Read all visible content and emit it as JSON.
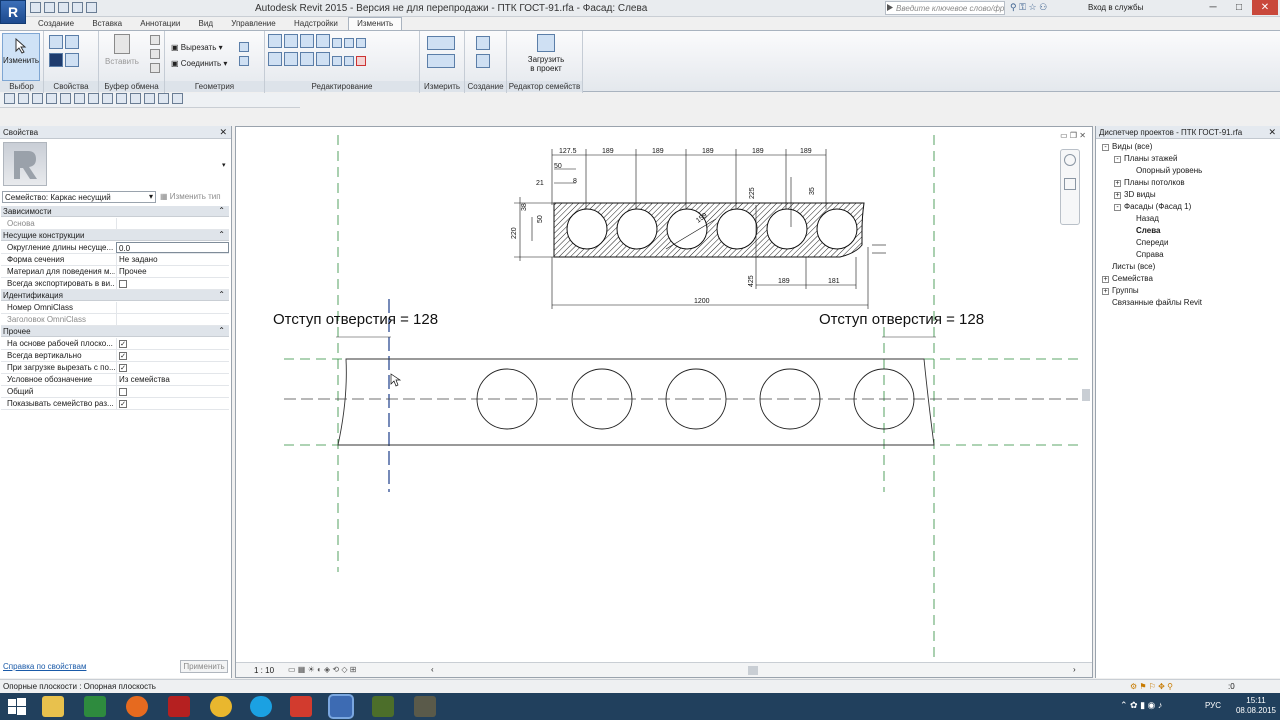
{
  "app": {
    "logo": "R",
    "title": "Autodesk Revit 2015 -  Версия не для перепродажи -    ПТК ГОСТ-91.rfa - Фасад: Слева",
    "search_placeholder": "Введите ключевое слово/фразу",
    "login_label": "Вход в службы",
    "win_min": "─",
    "win_max": "□",
    "win_close": "✕"
  },
  "tabs": [
    "Создание",
    "Вставка",
    "Аннотации",
    "Вид",
    "Управление",
    "Надстройки",
    "Изменить"
  ],
  "ribbon": {
    "modify_label": "Изменить",
    "panels": {
      "select": "Выбор",
      "properties": "Свойства",
      "clipboard": "Буфер обмена",
      "geometry": "Геометрия",
      "edit": "Редактирование",
      "measure": "Измерить",
      "create": "Создание",
      "family_editor": "Редактор семейств"
    },
    "paste_label": "Вставить",
    "cut_label": "Вырезать",
    "join_label": "Соединить",
    "load_label_1": "Загрузить",
    "load_label_2": "в проект"
  },
  "properties": {
    "title": "Свойства",
    "family_select": "Семейство: Каркас несущий",
    "edit_type": "Изменить тип",
    "groups": [
      {
        "name": "Зависимости",
        "rows": [
          {
            "k": "Основа",
            "v": "",
            "grey": true
          }
        ]
      },
      {
        "name": "Несущие конструкции",
        "rows": [
          {
            "k": "Округление длины несуще...",
            "v": "0.0"
          },
          {
            "k": "Форма сечения",
            "v": "Не задано"
          },
          {
            "k": "Материал для поведения м...",
            "v": "Прочее"
          },
          {
            "k": "Всегда экспортировать в ви...",
            "v": "",
            "check": false
          }
        ]
      },
      {
        "name": "Идентификация",
        "rows": [
          {
            "k": "Номер OmniClass",
            "v": ""
          },
          {
            "k": "Заголовок OmniClass",
            "v": "",
            "grey": true
          }
        ]
      },
      {
        "name": "Прочее",
        "rows": [
          {
            "k": "На основе рабочей плоско...",
            "v": "",
            "check": true
          },
          {
            "k": "Всегда вертикально",
            "v": "",
            "check": true
          },
          {
            "k": "При загрузке вырезать с по...",
            "v": "",
            "check": true
          },
          {
            "k": "Условное обозначение",
            "v": "Из семейства"
          },
          {
            "k": "Общий",
            "v": "",
            "check": false
          },
          {
            "k": "Показывать семейство раз...",
            "v": "",
            "check": true
          }
        ]
      }
    ],
    "help_link": "Справка по свойствам",
    "apply": "Применить"
  },
  "project_browser": {
    "title": "Диспетчер проектов - ПТК ГОСТ-91.rfa",
    "items": [
      {
        "label": "Виды (все)",
        "level": 0,
        "toggle": "-"
      },
      {
        "label": "Планы этажей",
        "level": 1,
        "toggle": "-"
      },
      {
        "label": "Опорный уровень",
        "level": 2,
        "toggle": ""
      },
      {
        "label": "Планы потолков",
        "level": 1,
        "toggle": "+"
      },
      {
        "label": "3D виды",
        "level": 1,
        "toggle": "+"
      },
      {
        "label": "Фасады (Фасад 1)",
        "level": 1,
        "toggle": "-"
      },
      {
        "label": "Назад",
        "level": 2,
        "toggle": ""
      },
      {
        "label": "Слева",
        "level": 2,
        "toggle": "",
        "bold": true
      },
      {
        "label": "Спереди",
        "level": 2,
        "toggle": ""
      },
      {
        "label": "Справа",
        "level": 2,
        "toggle": ""
      },
      {
        "label": "Листы (все)",
        "level": 0,
        "toggle": ""
      },
      {
        "label": "Семейства",
        "level": 0,
        "toggle": "+"
      },
      {
        "label": "Группы",
        "level": 0,
        "toggle": "+"
      },
      {
        "label": "Связанные файлы Revit",
        "level": 0,
        "toggle": ""
      }
    ]
  },
  "drawing": {
    "note_left": "Отступ отверстия = 128",
    "note_right": "Отступ отверстия = 128",
    "dims_top": [
      "127.5",
      "189",
      "189",
      "189",
      "189",
      "189"
    ],
    "dim_50": "50",
    "dim_21": "21",
    "dim_8": "8",
    "dim_38": "38",
    "dim_220": "220",
    "dim_225": "225",
    "dim_35": "35",
    "dim_159": "159",
    "dim_425": "425",
    "dim_189b": "189",
    "dim_181": "181",
    "dim_1200": "1200",
    "scale": "1 : 10"
  },
  "status": {
    "text": "Опорные плоскости : Опорная плоскость",
    "lang": "РУС",
    "time": "15:11",
    "date": "08.08.2015",
    "status_zero": ":0"
  }
}
